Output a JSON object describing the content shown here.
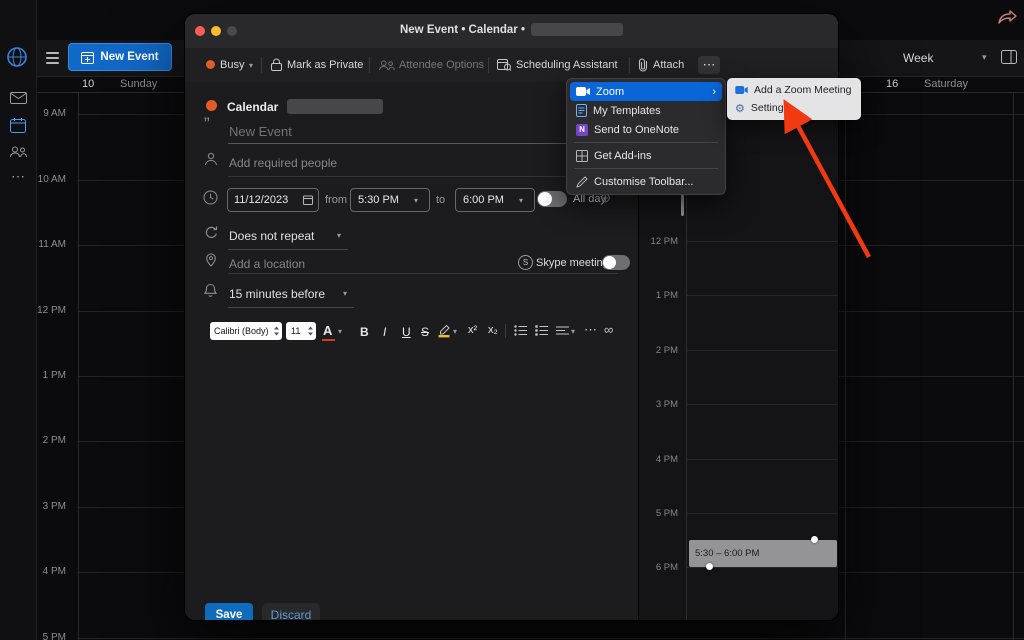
{
  "glyphs": {
    "chevron_down": "▾",
    "submenu_arrow": "›",
    "more_dots": "⋯",
    "globe": "⊕",
    "quote": "”",
    "link": "∞",
    "onenote_n": "N",
    "skype_s": "S",
    "gear": "⚙"
  },
  "top_bar": {
    "new_event_button": "New Event",
    "week_label": "Week"
  },
  "calendar_bg": {
    "left_day_num": "10",
    "left_day_name": "Sunday",
    "right_day_num": "16",
    "right_day_name": "Saturday",
    "left_times": [
      "9 AM",
      "10 AM",
      "11 AM",
      "12 PM",
      "1 PM",
      "2 PM",
      "3 PM",
      "4 PM",
      "5 PM"
    ]
  },
  "event_window": {
    "title": "New Event • Calendar •",
    "toolbar": {
      "busy": "Busy",
      "mark_private": "Mark as Private",
      "attendee_options": "Attendee Options",
      "scheduling_assistant": "Scheduling Assistant",
      "attach": "Attach"
    },
    "form": {
      "calendar_label": "Calendar",
      "title_placeholder": "New Event",
      "required_people_placeholder": "Add required people",
      "date": "11/12/2023",
      "from_label": "from",
      "start_time": "5:30 PM",
      "to_label": "to",
      "end_time": "6:00 PM",
      "all_day_label": "All day",
      "repeat_value": "Does not repeat",
      "location_placeholder": "Add a location",
      "skype_label": "Skype meeting",
      "reminder_value": "15 minutes before"
    },
    "format_bar": {
      "font_name": "Calibri (Body)",
      "font_size": "11",
      "color_letter": "A",
      "bold": "B",
      "italic": "I",
      "underline": "U",
      "strikethrough": "S",
      "superscript": "x²",
      "subscript": "x₂"
    },
    "footer": {
      "save": "Save",
      "discard": "Discard"
    }
  },
  "menu": {
    "items": [
      {
        "label": "Zoom"
      },
      {
        "label": "My Templates"
      },
      {
        "label": "Send to OneNote"
      },
      {
        "label": "Get Add-ins"
      },
      {
        "label": "Customise Toolbar..."
      }
    ]
  },
  "submenu": {
    "items": [
      {
        "label": "Add a Zoom Meeting"
      },
      {
        "label": "Settings"
      }
    ]
  },
  "day_panel": {
    "times": [
      "12 PM",
      "1 PM",
      "2 PM",
      "3 PM",
      "4 PM",
      "5 PM",
      "6 PM"
    ],
    "event_label": "5:30 – 6:00 PM"
  },
  "colors": {
    "accent_blue": "#0f6cbd",
    "menu_highlight": "#0a66d8",
    "arrow": "#f23a12",
    "busy_orange": "#e25d25"
  }
}
